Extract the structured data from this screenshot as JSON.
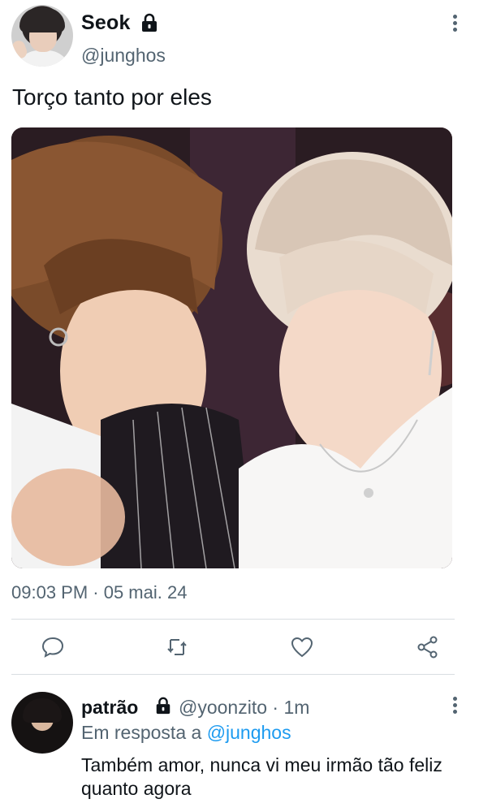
{
  "post": {
    "author": {
      "display_name": "Seok",
      "handle": "@junghos",
      "locked": true
    },
    "text": "Torço tanto por eles",
    "timestamp": "09:03 PM · 05 mai. 24",
    "image": {
      "description_icon": "photo"
    }
  },
  "actions": [
    {
      "name": "reply",
      "icon": "comment-icon"
    },
    {
      "name": "repost",
      "icon": "retweet-icon"
    },
    {
      "name": "like",
      "icon": "heart-icon"
    },
    {
      "name": "share",
      "icon": "share-icon"
    }
  ],
  "reply": {
    "author": {
      "display_name": "patrão",
      "handle": "@yoonzito",
      "locked": true
    },
    "handle_time": "@yoonzito · 1m",
    "in_reply_prefix": "Em resposta a",
    "in_reply_mention": "@junghos",
    "text": "Também amor, nunca vi meu irmão tão feliz quanto agora"
  },
  "colors": {
    "text_primary": "#0f1419",
    "text_secondary": "#536471",
    "link": "#1d9bf0",
    "divider": "#d9dee2"
  }
}
